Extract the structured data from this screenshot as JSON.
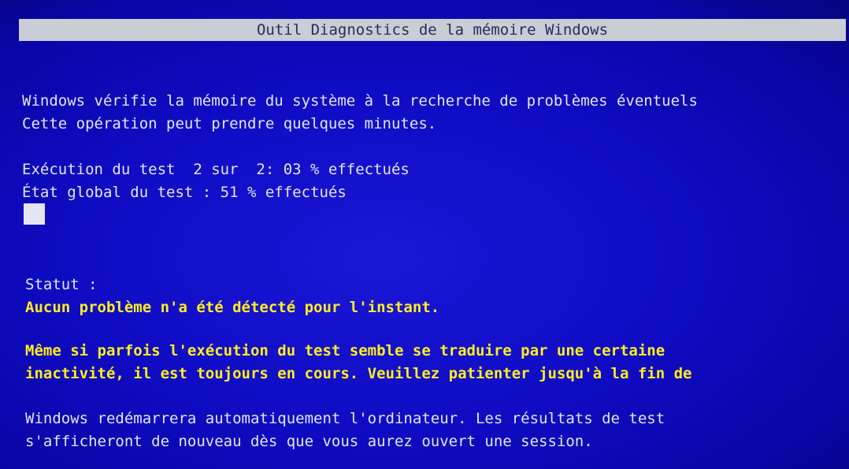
{
  "window": {
    "title": "Outil Diagnostics de la mémoire Windows"
  },
  "intro": {
    "line1": "Windows vérifie la mémoire du système à la recherche de problèmes éventuels",
    "line2": "Cette opération peut prendre quelques minutes."
  },
  "progress": {
    "test_line": "Exécution du test  2 sur  2: 03 % effectués",
    "overall_line": "État global du test : 51 % effectués",
    "current_test": 2,
    "total_tests": 2,
    "current_percent": 3,
    "overall_percent": 51
  },
  "status": {
    "label": "Statut :",
    "message": "Aucun problème n'a été détecté pour l'instant."
  },
  "notice": {
    "line1": "Même si parfois l'exécution du test semble se traduire par une certaine",
    "line2": "inactivité, il est toujours en cours. Veuillez patienter jusqu'à la fin de"
  },
  "restart": {
    "line1": "Windows redémarrera automatiquement l'ordinateur. Les résultats de test",
    "line2": "s'afficheront de nouveau dès que vous aurez ouvert une session."
  },
  "colors": {
    "background": "#0f0cc4",
    "text": "#e4e6f4",
    "highlight": "#ffee22",
    "title_bar": "#c9cdd4"
  }
}
